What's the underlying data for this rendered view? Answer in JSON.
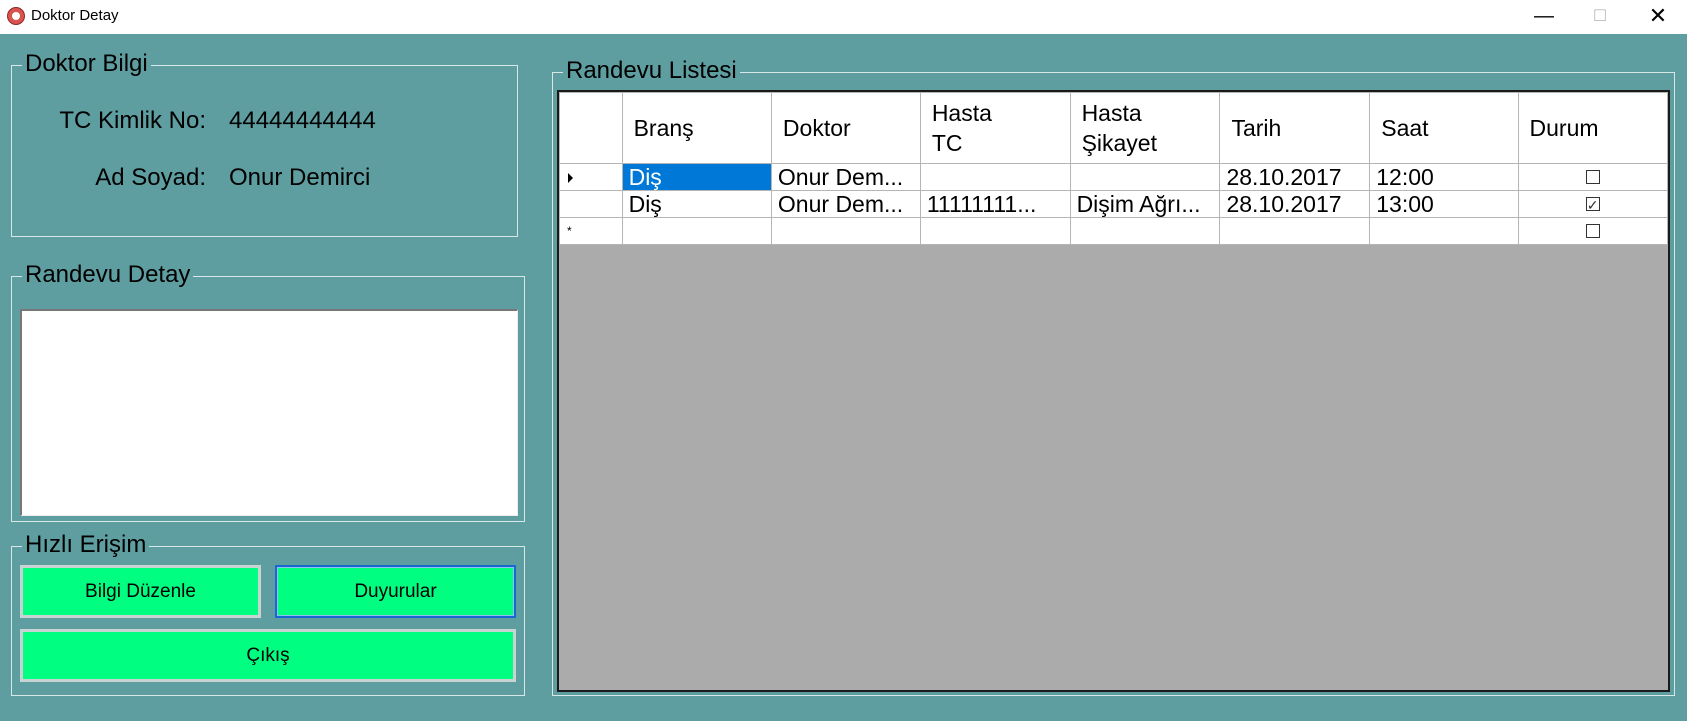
{
  "window": {
    "title": "Doktor Detay",
    "minimize": "—",
    "maximize": "☐",
    "close": "✕"
  },
  "doctor_info": {
    "legend": "Doktor Bilgi",
    "tc_label": "TC Kimlik No:",
    "tc_value": "44444444444",
    "name_label": "Ad Soyad:",
    "name_value": "Onur Demirci"
  },
  "appointment_detail": {
    "legend": "Randevu Detay",
    "text": ""
  },
  "quick_access": {
    "legend": "Hızlı Erişim",
    "edit_label": "Bilgi Düzenle",
    "announcements_label": "Duyurular",
    "exit_label": "Çıkış"
  },
  "appointment_list": {
    "legend": "Randevu Listesi",
    "columns": [
      "Branş",
      "Doktor",
      "Hasta\nTC",
      "Hasta\nŞikayet",
      "Tarih",
      "Saat",
      "Durum"
    ],
    "rows": [
      {
        "marker": "arrow",
        "brans": "Diş",
        "doktor": "Onur Dem...",
        "hasta_tc": "",
        "sikayet": "",
        "tarih": "28.10.2017",
        "saat": "12:00",
        "durum": false
      },
      {
        "marker": "",
        "brans": "Diş",
        "doktor": "Onur Dem...",
        "hasta_tc": "11111111...",
        "sikayet": "Dişim Ağrı...",
        "tarih": "28.10.2017",
        "saat": "13:00",
        "durum": true
      },
      {
        "marker": "new",
        "brans": "",
        "doktor": "",
        "hasta_tc": "",
        "sikayet": "",
        "tarih": "",
        "saat": "",
        "durum": false
      }
    ],
    "new_row_marker": "*"
  }
}
